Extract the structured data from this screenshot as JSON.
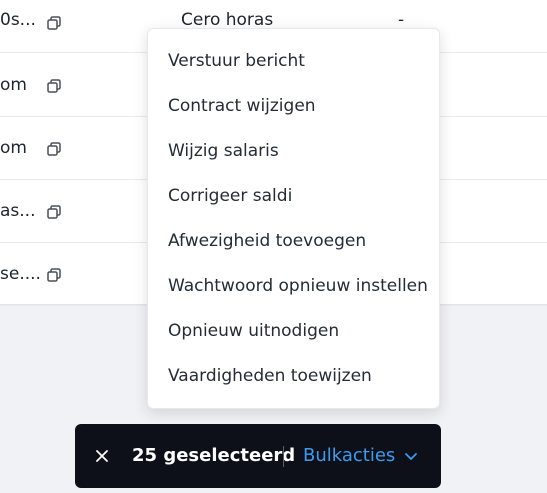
{
  "table": {
    "rows": [
      {
        "email": "0s...",
        "col3": "Cero horas",
        "col4": "-"
      },
      {
        "email": "om",
        "col3": "",
        "col4": ""
      },
      {
        "email": "om",
        "col3": "",
        "col4": ""
      },
      {
        "email": "as...",
        "col3": "",
        "col4": ""
      },
      {
        "email": "se....",
        "col3": "",
        "col4": ""
      }
    ],
    "copy_icon": "copy-icon"
  },
  "bulk_menu": {
    "items": [
      "Verstuur bericht",
      "Contract wijzigen",
      "Wijzig salaris",
      "Corrigeer saldi",
      "Afwezigheid toevoegen",
      "Wachtwoord opnieuw instellen",
      "Opnieuw uitnodigen",
      "Vaardigheden toewijzen"
    ]
  },
  "bulk_bar": {
    "close_icon": "close-icon",
    "selected_count": "25 geselecteerd",
    "actions_label": "Bulkacties",
    "chevron_icon": "chevron-down-icon"
  },
  "colors": {
    "bar_background": "#0d1018",
    "accent": "#3d9bf0",
    "page_background": "#f1f2f5"
  }
}
